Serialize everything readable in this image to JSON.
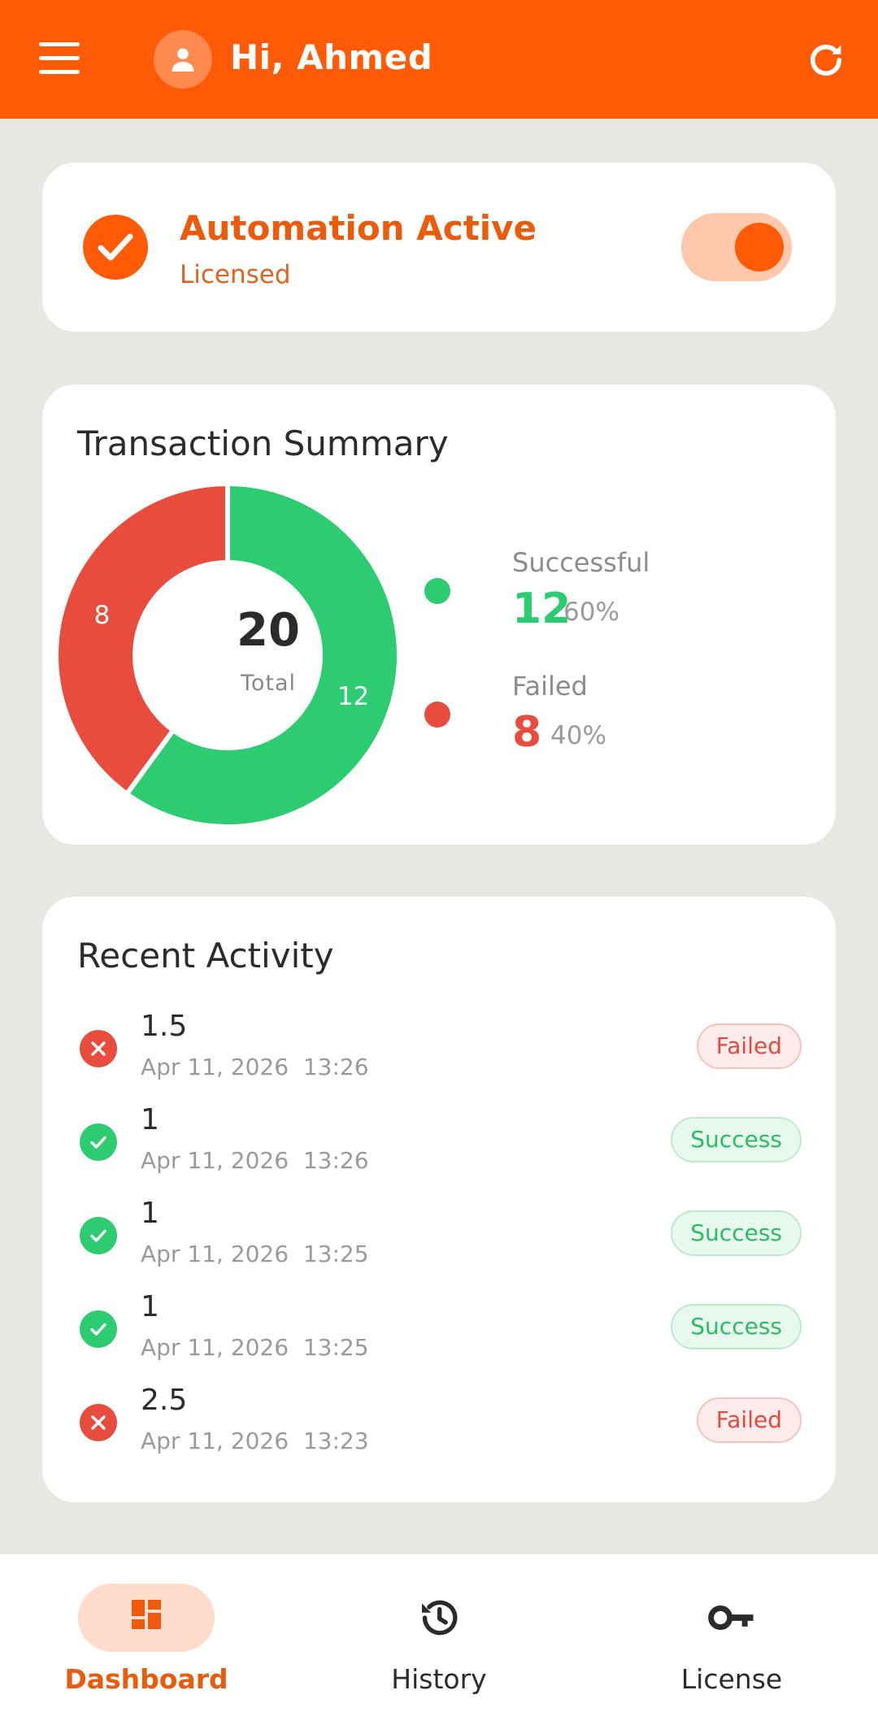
{
  "header": {
    "greeting": "Hi, Ahmed",
    "background_color": "#ff5a05"
  },
  "status": {
    "title": "Automation Active",
    "subtitle": "Licensed",
    "toggle_on": true
  },
  "summary": {
    "title": "Transaction Summary",
    "total_value": "20",
    "total_label": "Total",
    "legend": [
      {
        "label": "Successful",
        "value": "12",
        "percent": "60%",
        "color": "#2ecc71"
      },
      {
        "label": "Failed",
        "value": "8",
        "percent": "40%",
        "color": "#e74c3c"
      }
    ]
  },
  "chart_data": {
    "type": "pie",
    "variant": "donut",
    "categories": [
      "Successful",
      "Failed"
    ],
    "values": [
      12,
      8
    ],
    "slice_labels": [
      "12",
      "8"
    ],
    "colors": [
      "#2ecc71",
      "#e74c3c"
    ],
    "center_value": "20",
    "center_label": "Total"
  },
  "activity": {
    "title": "Recent Activity",
    "items": [
      {
        "amount": "1.5",
        "date": "Apr 11, 2026",
        "time": "13:26",
        "status": "Failed"
      },
      {
        "amount": "1",
        "date": "Apr 11, 2026",
        "time": "13:26",
        "status": "Success"
      },
      {
        "amount": "1",
        "date": "Apr 11, 2026",
        "time": "13:25",
        "status": "Success"
      },
      {
        "amount": "1",
        "date": "Apr 11, 2026",
        "time": "13:25",
        "status": "Success"
      },
      {
        "amount": "2.5",
        "date": "Apr 11, 2026",
        "time": "13:23",
        "status": "Failed"
      }
    ]
  },
  "nav": {
    "items": [
      {
        "label": "Dashboard",
        "icon": "dashboard-icon",
        "active": true
      },
      {
        "label": "History",
        "icon": "history-icon",
        "active": false
      },
      {
        "label": "License",
        "icon": "key-icon",
        "active": false
      }
    ],
    "accent_color": "#ec5a0c"
  }
}
